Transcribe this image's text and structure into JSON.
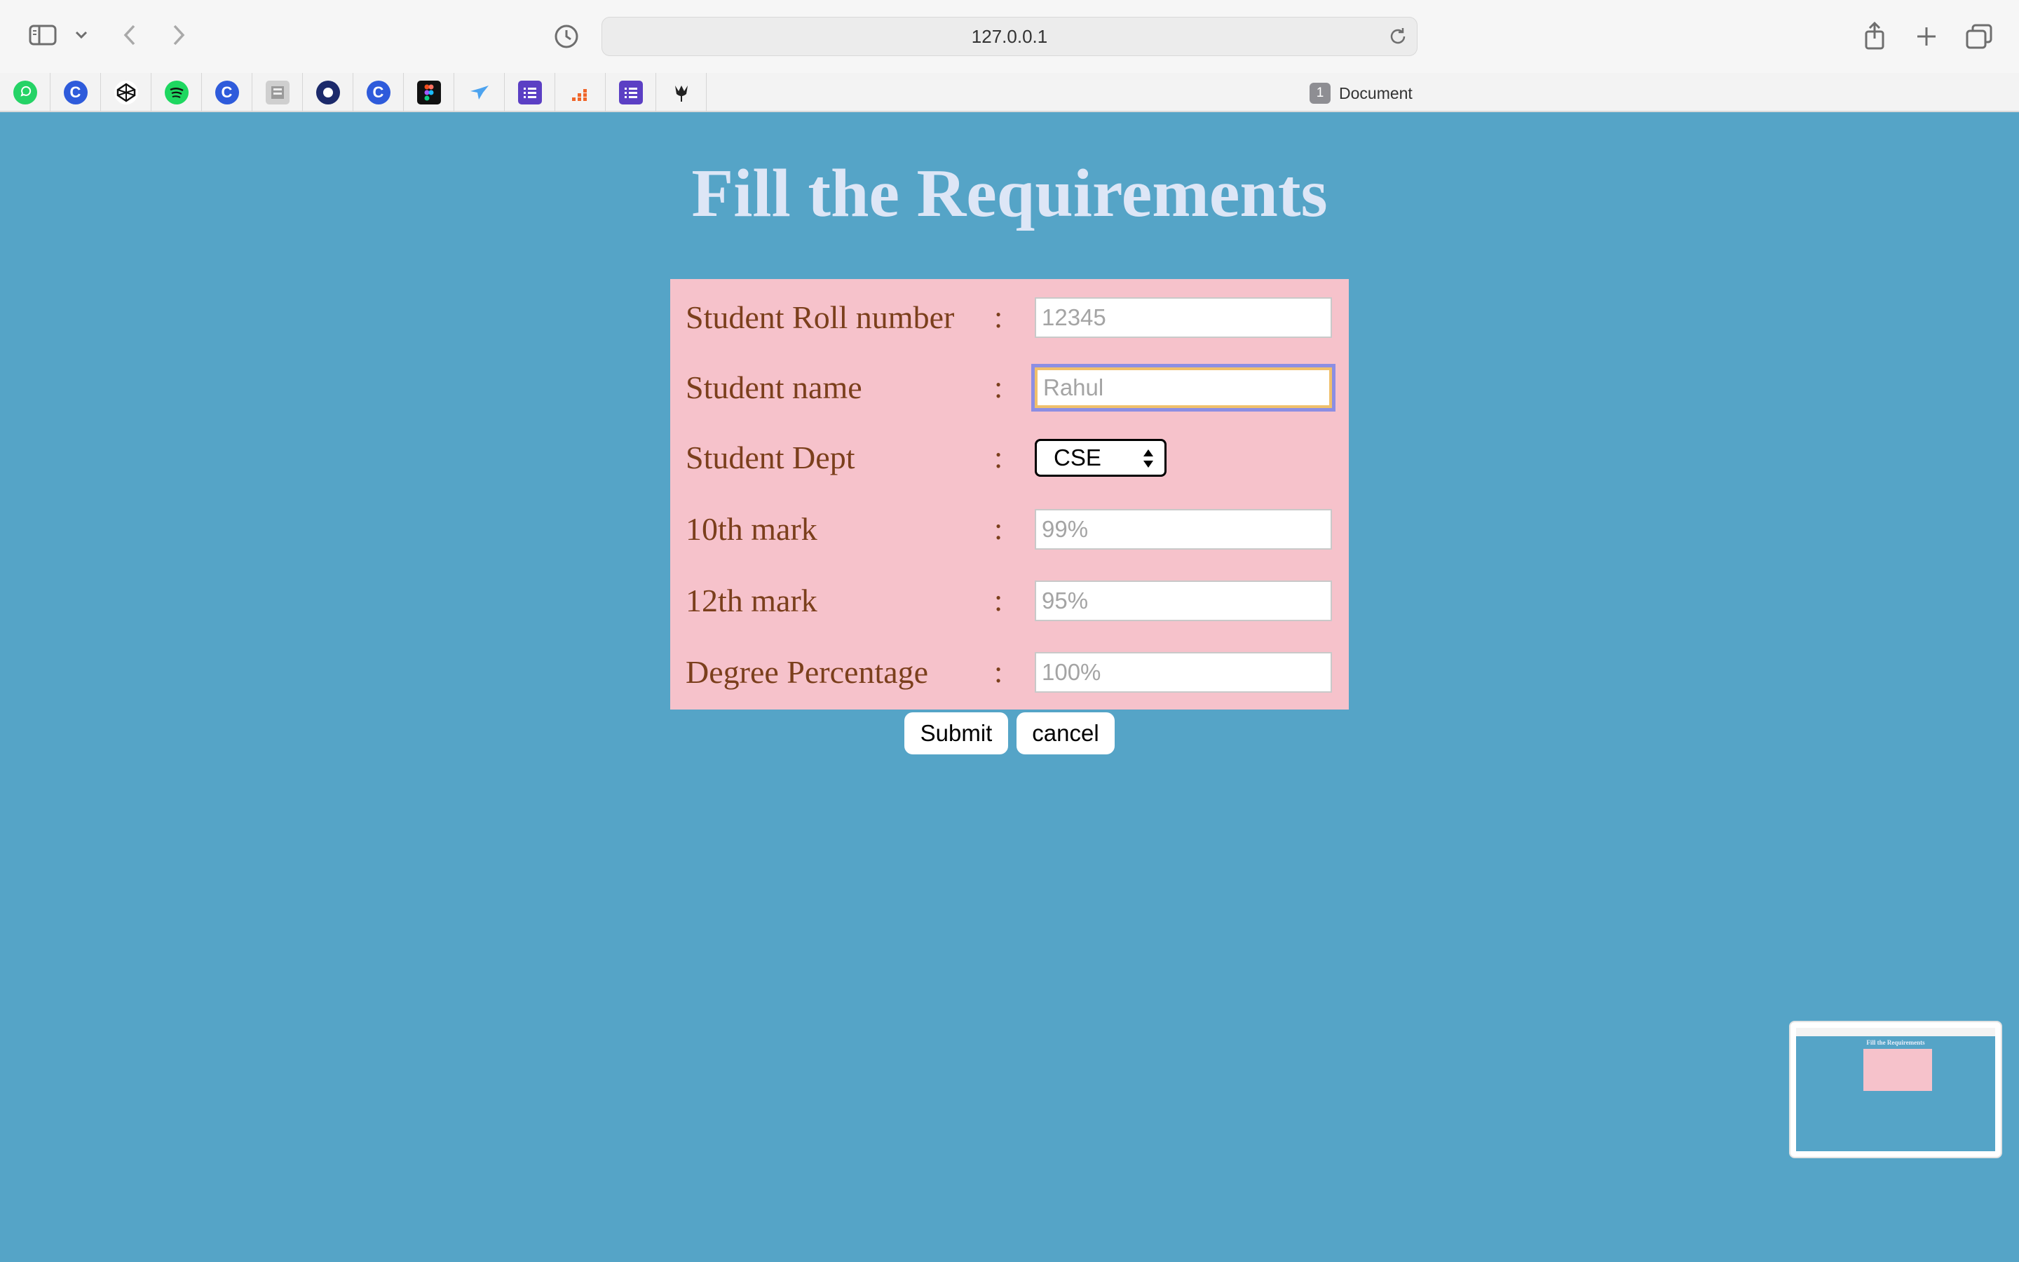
{
  "browser": {
    "url": "127.0.0.1",
    "tab_count": "1",
    "tab_title": "Document",
    "bookmarks": [
      {
        "icon": "whatsapp-icon",
        "color": "#25d366"
      },
      {
        "icon": "c-logo-icon",
        "color": "#2e5bdb"
      },
      {
        "icon": "codepen-icon",
        "color": "#111111"
      },
      {
        "icon": "spotify-icon",
        "color": "#1ed760"
      },
      {
        "icon": "c-logo-icon",
        "color": "#2e5bdb"
      },
      {
        "icon": "document-scan-icon",
        "color": "#777777"
      },
      {
        "icon": "circle-icon",
        "color": "#1c2a6b"
      },
      {
        "icon": "c-logo-icon",
        "color": "#2e5bdb"
      },
      {
        "icon": "figma-icon",
        "color": "#111111"
      },
      {
        "icon": "bird-icon",
        "color": "#4ca3ef"
      },
      {
        "icon": "list-icon",
        "color": "#5b3fc4"
      },
      {
        "icon": "bars-icon",
        "color": "#f0662a"
      },
      {
        "icon": "list-icon",
        "color": "#5b3fc4"
      },
      {
        "icon": "tulip-icon",
        "color": "#222222"
      }
    ]
  },
  "page": {
    "title": "Fill the Requirements",
    "separator": ":",
    "fields": [
      {
        "label": "Student Roll number",
        "placeholder": "12345"
      },
      {
        "label": "Student name",
        "placeholder": "Rahul"
      },
      {
        "label": "Student Dept",
        "selected": "CSE"
      },
      {
        "label": "10th mark",
        "placeholder": "99%"
      },
      {
        "label": "12th mark",
        "placeholder": "95%"
      },
      {
        "label": "Degree Percentage",
        "placeholder": "100%"
      }
    ],
    "submit_label": "Submit",
    "cancel_label": "cancel"
  },
  "thumbnail": {
    "title": "Fill the Requirements"
  },
  "colors": {
    "page_background": "#55a4c7",
    "form_background": "#f6c2cb",
    "label_color": "#7b3f1c",
    "title_color": "#dde6f6"
  }
}
